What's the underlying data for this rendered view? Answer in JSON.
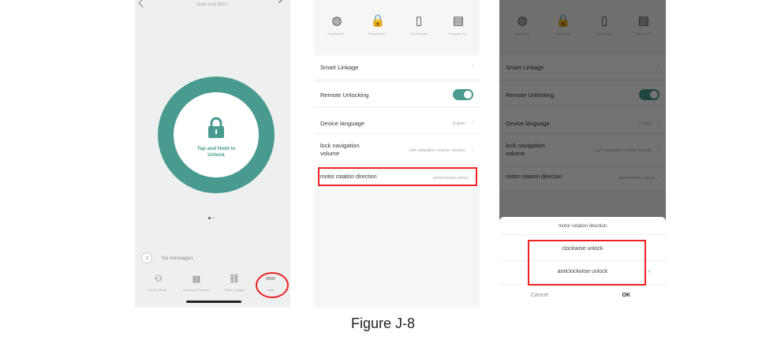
{
  "phone1": {
    "subtitle": "Ezviz Lock DL0 L",
    "tap_hold": "Tap and Hold to Unlock",
    "message": "No messages",
    "tabs": [
      {
        "glyph": "⚇",
        "label": "Family Mana..."
      },
      {
        "glyph": "▤",
        "label": "Unlocking Records"
      },
      {
        "glyph": "⛓",
        "label": "Smart Linkage"
      },
      {
        "glyph": "ooo",
        "label": "More"
      }
    ],
    "colors": {
      "accent": "#4a9b8f",
      "highlight": "#e22222"
    }
  },
  "settings": {
    "toolbar": [
      {
        "glyph": "◍",
        "label": "Fingerprint M..."
      },
      {
        "glyph": "🔒",
        "label": "Password Ma..."
      },
      {
        "glyph": "▯",
        "label": "Card Manager"
      },
      {
        "glyph": "▤",
        "label": "Temporary Pa..."
      }
    ],
    "rows": {
      "smart_linkage": "Smart Linkage",
      "remote_unlocking": "Remote Unlocking",
      "device_language": "Device language",
      "device_language_value": "English",
      "lock_nav_volume": "lock navigation volume",
      "lock_nav_volume_value": "lock navigation volume: medium",
      "motor_rotation": "motor rotation direction",
      "motor_rotation_value": "anticlockwise unlock"
    },
    "chevron": "›",
    "remote_unlocking_enabled": true
  },
  "sheet": {
    "title": "motor rotation direction",
    "option1": "clockwise unlock",
    "option2": "anticlockwise unlock",
    "check": "✓",
    "cancel": "Cancel",
    "ok": "OK"
  },
  "caption": "Figure J-8"
}
